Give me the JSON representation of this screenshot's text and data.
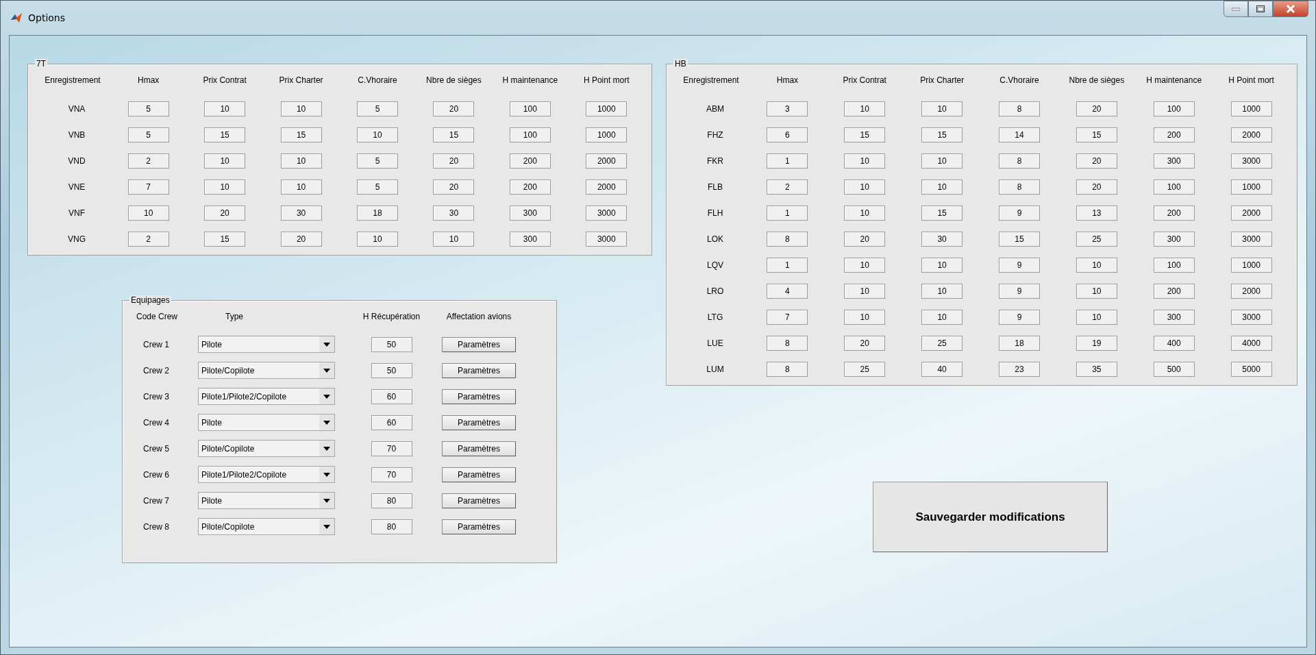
{
  "window": {
    "title": "Options"
  },
  "fleets": [
    {
      "title": "7T",
      "columns": [
        "Enregistrement",
        "Hmax",
        "Prix Contrat",
        "Prix Charter",
        "C.Vhoraire",
        "Nbre de sièges",
        "H maintenance",
        "H Point mort"
      ],
      "rows": [
        {
          "registration": "VNA",
          "values": [
            "5",
            "10",
            "10",
            "5",
            "20",
            "100",
            "1000"
          ]
        },
        {
          "registration": "VNB",
          "values": [
            "5",
            "15",
            "15",
            "10",
            "15",
            "100",
            "1000"
          ]
        },
        {
          "registration": "VND",
          "values": [
            "2",
            "10",
            "10",
            "5",
            "20",
            "200",
            "2000"
          ]
        },
        {
          "registration": "VNE",
          "values": [
            "7",
            "10",
            "10",
            "5",
            "20",
            "200",
            "2000"
          ]
        },
        {
          "registration": "VNF",
          "values": [
            "10",
            "20",
            "30",
            "18",
            "30",
            "300",
            "3000"
          ]
        },
        {
          "registration": "VNG",
          "values": [
            "2",
            "15",
            "20",
            "10",
            "10",
            "300",
            "3000"
          ]
        }
      ]
    },
    {
      "title": "HB",
      "columns": [
        "Enregistrement",
        "Hmax",
        "Prix Contrat",
        "Prix Charter",
        "C.Vhoraire",
        "Nbre de sièges",
        "H maintenance",
        "H Point mort"
      ],
      "rows": [
        {
          "registration": "ABM",
          "values": [
            "3",
            "10",
            "10",
            "8",
            "20",
            "100",
            "1000"
          ]
        },
        {
          "registration": "FHZ",
          "values": [
            "6",
            "15",
            "15",
            "14",
            "15",
            "200",
            "2000"
          ]
        },
        {
          "registration": "FKR",
          "values": [
            "1",
            "10",
            "10",
            "8",
            "20",
            "300",
            "3000"
          ]
        },
        {
          "registration": "FLB",
          "values": [
            "2",
            "10",
            "10",
            "8",
            "20",
            "100",
            "1000"
          ]
        },
        {
          "registration": "FLH",
          "values": [
            "1",
            "10",
            "15",
            "9",
            "13",
            "200",
            "2000"
          ]
        },
        {
          "registration": "LOK",
          "values": [
            "8",
            "20",
            "30",
            "15",
            "25",
            "300",
            "3000"
          ]
        },
        {
          "registration": "LQV",
          "values": [
            "1",
            "10",
            "10",
            "9",
            "10",
            "100",
            "1000"
          ]
        },
        {
          "registration": "LRO",
          "values": [
            "4",
            "10",
            "10",
            "9",
            "10",
            "200",
            "2000"
          ]
        },
        {
          "registration": "LTG",
          "values": [
            "7",
            "10",
            "10",
            "9",
            "10",
            "300",
            "3000"
          ]
        },
        {
          "registration": "LUE",
          "values": [
            "8",
            "20",
            "25",
            "18",
            "19",
            "400",
            "4000"
          ]
        },
        {
          "registration": "LUM",
          "values": [
            "8",
            "25",
            "40",
            "23",
            "35",
            "500",
            "5000"
          ]
        }
      ]
    }
  ],
  "crew_panel": {
    "title": "Equipages",
    "columns": [
      "Code Crew",
      "Type",
      "H Récupération",
      "Affectation avions"
    ],
    "rows": [
      {
        "code": "Crew 1",
        "type": "Pilote",
        "recovery": "50",
        "button": "Paramètres"
      },
      {
        "code": "Crew 2",
        "type": "Pilote/Copilote",
        "recovery": "50",
        "button": "Paramètres"
      },
      {
        "code": "Crew 3",
        "type": "Pilote1/Pilote2/Copilote",
        "recovery": "60",
        "button": "Paramètres"
      },
      {
        "code": "Crew 4",
        "type": "Pilote",
        "recovery": "60",
        "button": "Paramètres"
      },
      {
        "code": "Crew 5",
        "type": "Pilote/Copilote",
        "recovery": "70",
        "button": "Paramètres"
      },
      {
        "code": "Crew 6",
        "type": "Pilote1/Pilote2/Copilote",
        "recovery": "70",
        "button": "Paramètres"
      },
      {
        "code": "Crew 7",
        "type": "Pilote",
        "recovery": "80",
        "button": "Paramètres"
      },
      {
        "code": "Crew 8",
        "type": "Pilote/Copilote",
        "recovery": "80",
        "button": "Paramètres"
      }
    ]
  },
  "save_button": "Sauvegarder modifications"
}
